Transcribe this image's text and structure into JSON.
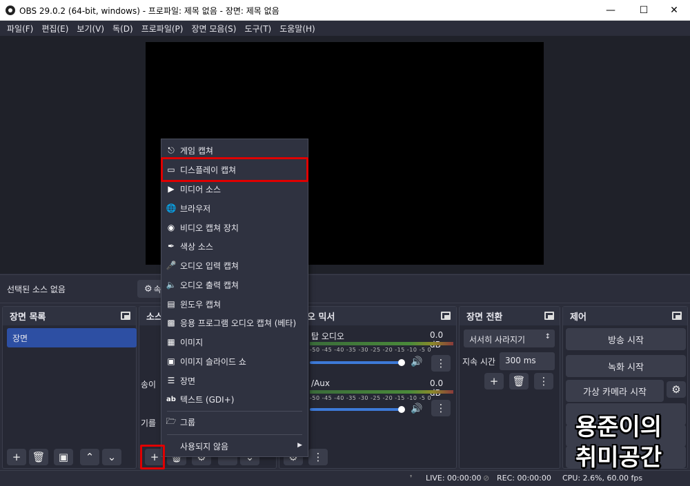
{
  "window": {
    "title": "OBS 29.0.2 (64-bit, windows) - 프로파일: 제목 없음 - 장면: 제목 없음"
  },
  "menubar": [
    "파일(F)",
    "편집(E)",
    "보기(V)",
    "독(D)",
    "프로파일(P)",
    "장면 모음(S)",
    "도구(T)",
    "도움말(H)"
  ],
  "source_bar": {
    "no_source": "선택된 소스 없음",
    "props_label": "속"
  },
  "scenes": {
    "title": "장면 목록",
    "items": [
      "장면"
    ]
  },
  "sources": {
    "title": "소스",
    "partial_1": "송이",
    "partial_2": "기를"
  },
  "mixer": {
    "title": "오디오 믹서",
    "title_visible": "오 믹서",
    "channels": [
      {
        "name": "데스크탑 오디오",
        "name_visible": "탑 오디오",
        "db": "0.0 dB",
        "volume": 0.85
      },
      {
        "name": "Mic/Aux",
        "name_visible": "/Aux",
        "db": "0.0 dB",
        "volume": 0.85
      }
    ],
    "scale": "-50 -45 -40 -35 -30 -25 -20 -15 -10 -5 0"
  },
  "transitions": {
    "title": "장면 전환",
    "type": "서서히 사라지기",
    "duration_label": "지속 시간",
    "duration": "300 ms"
  },
  "controls": {
    "title": "제어",
    "start_stream": "방송 시작",
    "start_record": "녹화 시작",
    "virtual_cam": "가상 카메라 시작"
  },
  "context_menu": {
    "items": [
      {
        "label": "게임 캡쳐",
        "icon": "gamepad-icon"
      },
      {
        "label": "디스플레이 캡쳐",
        "icon": "monitor-icon",
        "highlighted": true
      },
      {
        "label": "미디어 소스",
        "icon": "play-icon"
      },
      {
        "label": "브라우저",
        "icon": "globe-icon"
      },
      {
        "label": "비디오 캡쳐 장치",
        "icon": "camera-icon"
      },
      {
        "label": "색상 소스",
        "icon": "brush-icon"
      },
      {
        "label": "오디오 입력 캡쳐",
        "icon": "microphone-icon"
      },
      {
        "label": "오디오 출력 캡쳐",
        "icon": "speaker-icon"
      },
      {
        "label": "윈도우 캡쳐",
        "icon": "window-icon"
      },
      {
        "label": "응용 프로그램 오디오 캡쳐 (베타)",
        "icon": "app-audio-icon"
      },
      {
        "label": "이미지",
        "icon": "image-icon"
      },
      {
        "label": "이미지 슬라이드 쇼",
        "icon": "slideshow-icon"
      },
      {
        "label": "장면",
        "icon": "list-icon"
      },
      {
        "label": "텍스트 (GDI+)",
        "icon": "text-icon"
      }
    ],
    "group": "그룹",
    "deprecated": "사용되지 않음"
  },
  "status": {
    "live": "LIVE: 00:00:00",
    "rec": "REC: 00:00:00",
    "cpu": "CPU: 2.6%, 60.00 fps"
  },
  "watermark": [
    "용준이의",
    "취미공간"
  ],
  "colors": {
    "highlight": "#e00000",
    "accent": "#2d4fa3",
    "panel": "#262834"
  }
}
